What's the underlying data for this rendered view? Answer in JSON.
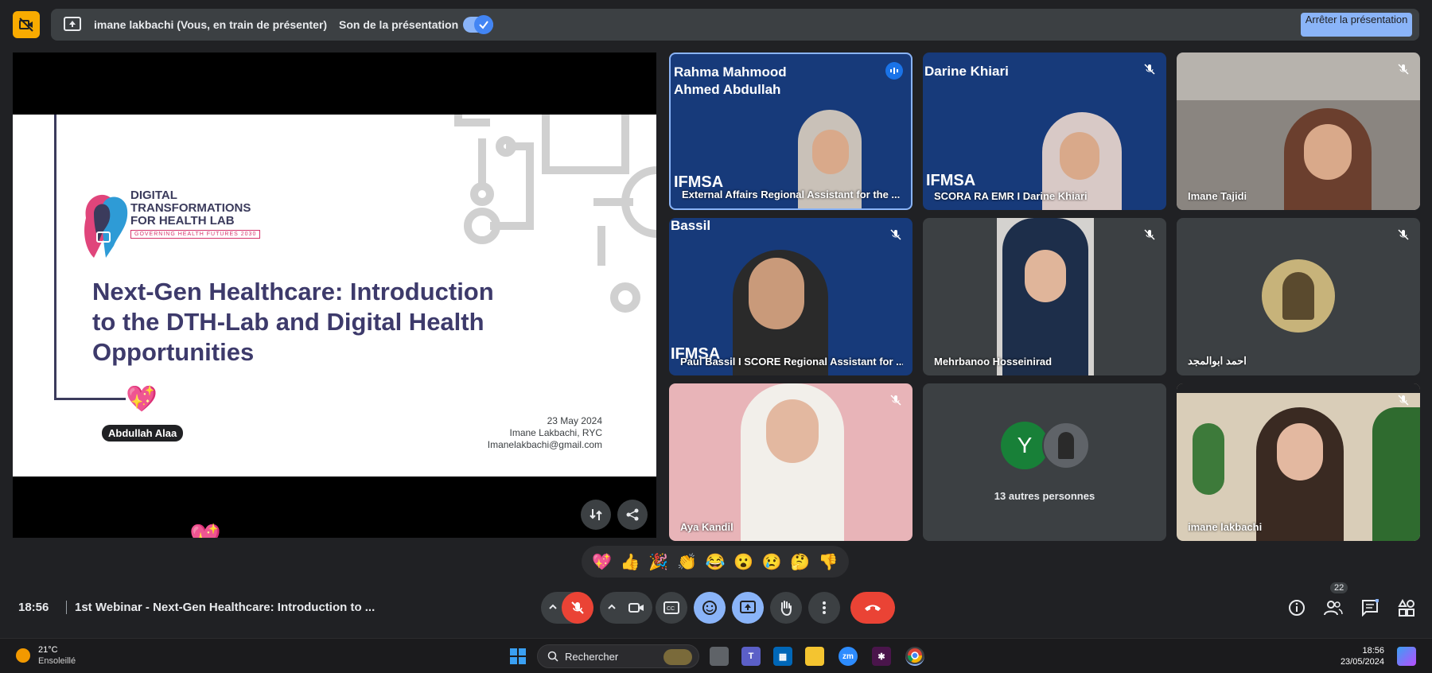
{
  "topbar": {
    "presenter_text": "imane lakbachi (Vous, en train de présenter)",
    "sound_label": "Son de la présentation",
    "stop_button": "Arrêter la présentation"
  },
  "slide": {
    "logo_title": "DIGITAL TRANSFORMATIONS FOR HEALTH LAB",
    "logo_subtitle": "GOVERNING HEALTH FUTURES 2030",
    "headline": "Next-Gen Healthcare: Introduction to the DTH-Lab and Digital Health Opportunities",
    "date": "23 May 2024",
    "author": "Imane Lakbachi, RYC",
    "email": "Imanelakbachi@gmail.com",
    "reaction_label": "Abdullah Alaa"
  },
  "tiles": [
    {
      "name": "External Affairs Regional Assistant for the ...",
      "overlay": "Rahma Mahmood Ahmed Abdullah",
      "brand": "IFMSA"
    },
    {
      "name": "SCORA RA EMR I Darine Khiari",
      "overlay": "Darine Khiari",
      "brand": "IFMSA"
    },
    {
      "name": "Imane Tajidi"
    },
    {
      "name": "Paul Bassil I SCORE Regional Assistant for ...",
      "overlay": "Bassil",
      "brand": "IFMSA"
    },
    {
      "name": "Mehrbanoo Hosseinirad"
    },
    {
      "name": "احمد ابوالمجد"
    },
    {
      "name": "Aya Kandil"
    },
    {
      "name": "13 autres personnes",
      "avatar_letter": "Y"
    },
    {
      "name": "imane lakbachi"
    }
  ],
  "reactions": [
    "💖",
    "👍",
    "🎉",
    "👏",
    "😂",
    "😮",
    "😢",
    "🤔",
    "👎"
  ],
  "bottom": {
    "time": "18:56",
    "meeting_title": "1st Webinar - Next-Gen Healthcare: Introduction to ...",
    "participants_count": "22"
  },
  "taskbar": {
    "temperature": "21°C",
    "weather": "Ensoleillé",
    "search_placeholder": "Rechercher",
    "clock_time": "18:56",
    "clock_date": "23/05/2024"
  },
  "colors": {
    "accent": "#8ab4f8",
    "end_call": "#ea4335",
    "background": "#202124",
    "cam_off": "#f9ab00"
  }
}
